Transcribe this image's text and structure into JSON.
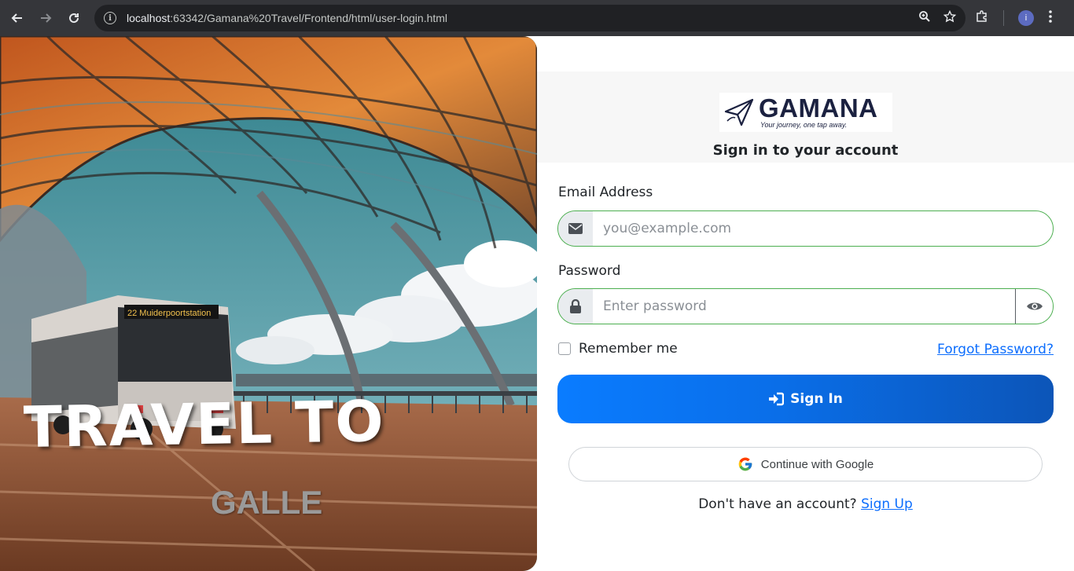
{
  "browser": {
    "url_host": "localhost",
    "url_rest": ":63342/Gamana%20Travel/Frontend/html/user-login.html",
    "avatar_letter": "i"
  },
  "hero": {
    "title": "TRAVEL TO",
    "subtitle": "GALLE",
    "bus_sign": "22  Muiderpoortstation"
  },
  "brand": {
    "name": "GAMANA",
    "tagline": "Your journey, one tap away."
  },
  "form": {
    "heading": "Sign in to your account",
    "email_label": "Email Address",
    "email_placeholder": "you@example.com",
    "password_label": "Password",
    "password_placeholder": "Enter password",
    "remember_label": "Remember me",
    "forgot_label": "Forgot Password?",
    "signin_label": "Sign In",
    "google_label": "Continue with Google",
    "signup_prompt": "Don't have an account?",
    "signup_link": "Sign Up"
  },
  "colors": {
    "primary": "#0a6ee8",
    "input_border": "#4caf50",
    "link": "#0d6efd",
    "brand_navy": "#1b2140"
  }
}
